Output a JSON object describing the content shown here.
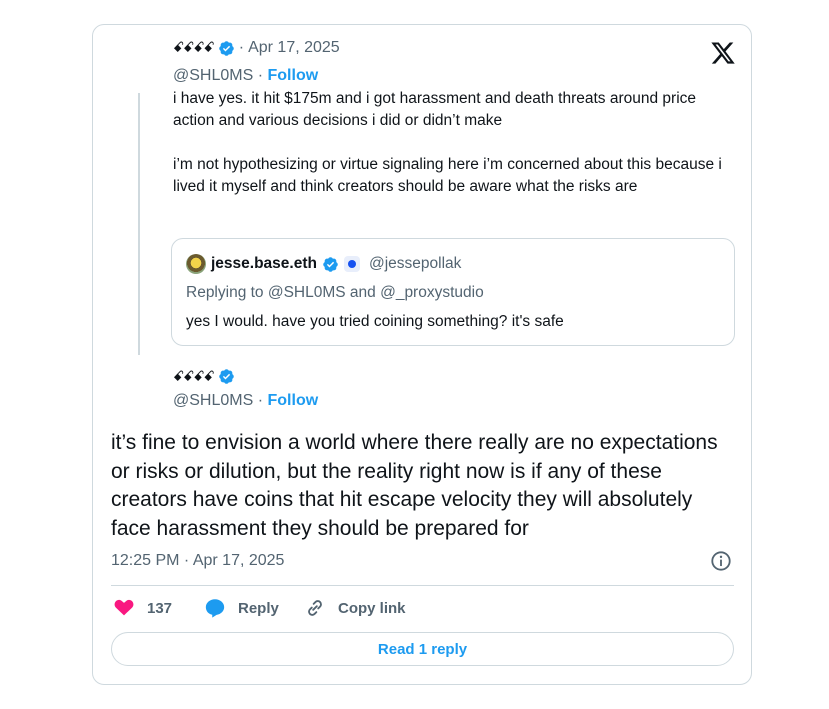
{
  "parent_tweet": {
    "author_name": "ꗃꗃꗃꗃ",
    "date": "Apr 17, 2025",
    "handle": "@SHL0MS",
    "follow_label": "Follow",
    "text_p1": "i have yes. it hit $175m and i got harassment and death threats around price action and various decisions i did or didn’t make",
    "text_p2": "i’m not hypothesizing or virtue signaling here i’m concerned about this because i lived it myself and think creators should be aware what the risks are"
  },
  "quoted_tweet": {
    "author_name": "jesse.base.eth",
    "handle": "@jessepollak",
    "replying_to": "Replying to @SHL0MS and @_proxystudio",
    "text": "yes I would. have you tried coining something? it's safe"
  },
  "main_tweet": {
    "author_name": "ꗃꗃꗃꗃ",
    "handle": "@SHL0MS",
    "follow_label": "Follow",
    "text": "it’s fine to envision a world where there really are no expectations or risks or dilution, but the reality right now is if any of these creators have coins that hit escape velocity they will absolutely face harassment they should be prepared for",
    "timestamp": "12:25 PM · Apr 17, 2025"
  },
  "actions": {
    "like_count": "137",
    "reply_label": "Reply",
    "copy_label": "Copy link",
    "read_replies_label": "Read 1 reply"
  },
  "icons": {
    "verified": "verified-badge-icon",
    "x_logo": "x-logo-icon",
    "like": "heart-icon",
    "reply": "speech-bubble-icon",
    "copy": "link-icon",
    "info": "info-icon"
  },
  "colors": {
    "accent": "#1d9bf0",
    "like": "#f91880",
    "muted": "#536471",
    "border": "#cfd9de"
  }
}
